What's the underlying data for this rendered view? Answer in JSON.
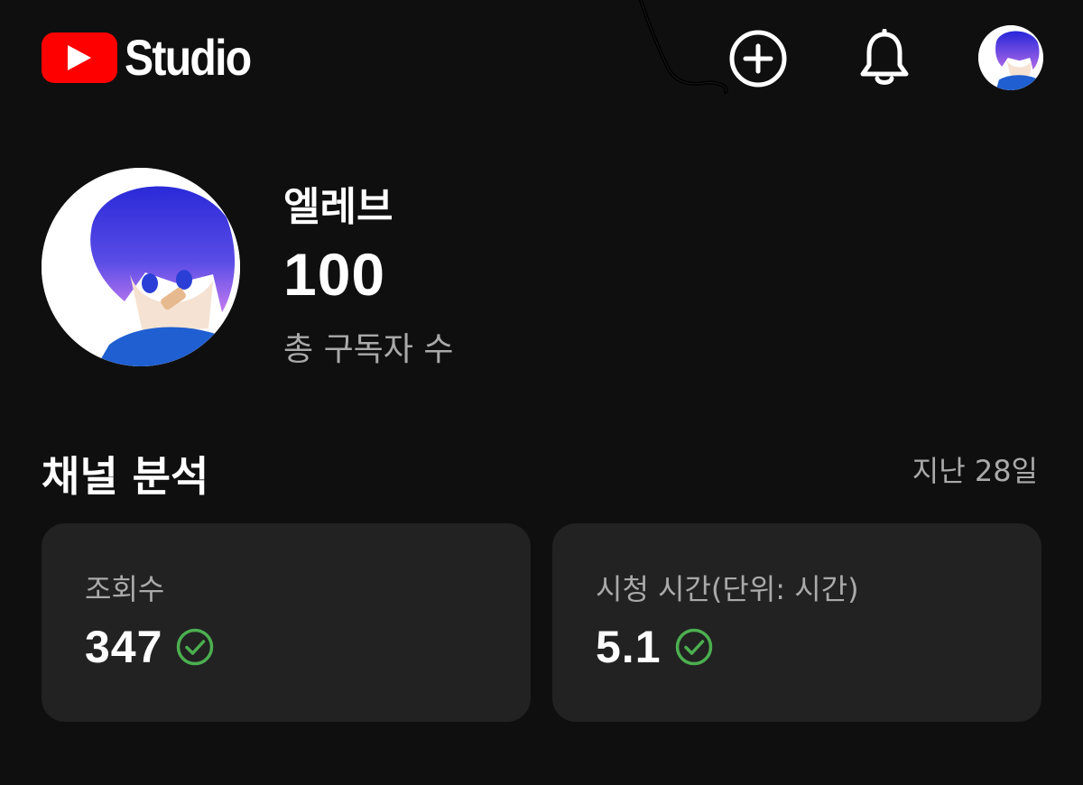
{
  "header": {
    "logo_text": "Studio",
    "brand_color": "#ff0000",
    "icons": [
      "create-icon",
      "bell-icon",
      "avatar"
    ]
  },
  "channel": {
    "name": "엘레브",
    "subscriber_count": "100",
    "subscriber_label": "총 구독자 수"
  },
  "analytics": {
    "title": "채널 분석",
    "period": "지난 28일",
    "cards": [
      {
        "label": "조회수",
        "value": "347",
        "status_icon": "check-circle-icon",
        "status_color": "#4caf50"
      },
      {
        "label": "시청 시간(단위: 시간)",
        "value": "5.1",
        "status_icon": "check-circle-icon",
        "status_color": "#4caf50"
      }
    ]
  }
}
